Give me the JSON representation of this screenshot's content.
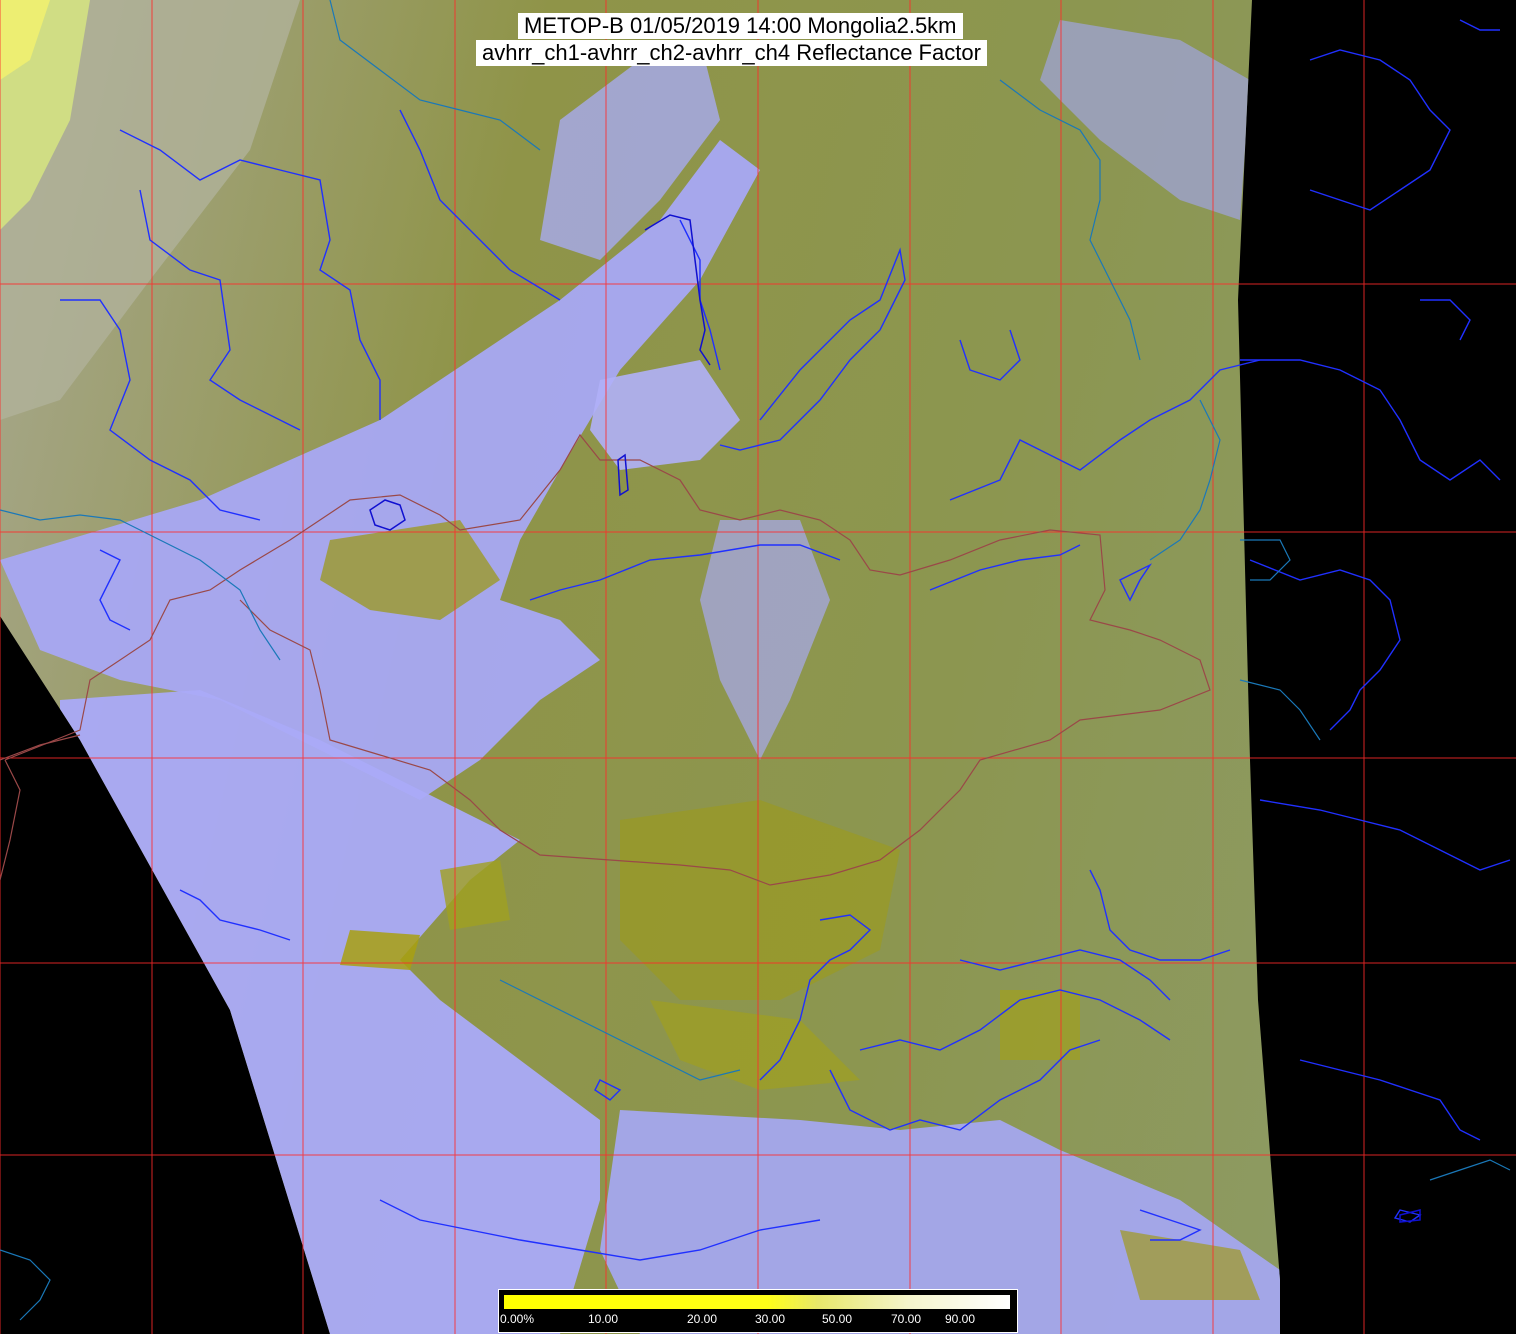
{
  "title": {
    "line1": "METOP-B 01/05/2019 14:00 Mongolia2.5km",
    "line2": "avhrr_ch1-avhrr_ch2-avhrr_ch4 Reflectance Factor"
  },
  "legend": {
    "labels": [
      "0.00%",
      "10.00",
      "20.00",
      "30.00",
      "50.00",
      "70.00",
      "90.00"
    ],
    "colors": [
      "#ffff00",
      "#ffff00",
      "#f0f040",
      "#e8e890",
      "#f4f4d0",
      "#ffffff"
    ]
  },
  "map": {
    "background": "#000000",
    "land_color": "#8c8f3c",
    "cloud_color": "#a8a8ff",
    "grid_color": "#ff2020",
    "river_color": "#2020ff",
    "coast_color": "#1870b0",
    "border_color": "#a05050"
  }
}
